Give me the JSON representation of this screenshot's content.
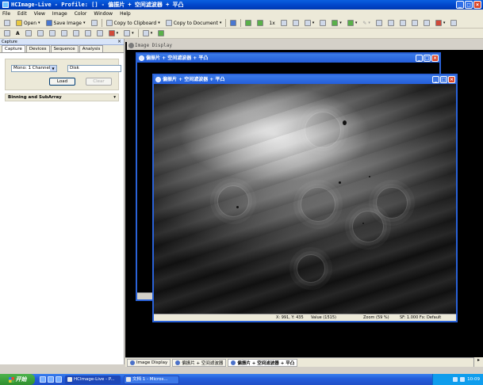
{
  "app": {
    "title": "HCImage-Live - Profile: [] - 偏振片 + 空间滤波器 + 平凸",
    "window_buttons": {
      "minimize": "_",
      "maximize": "□",
      "close": "×"
    }
  },
  "menu": [
    "File",
    "Edit",
    "View",
    "Image",
    "Color",
    "Window",
    "Help"
  ],
  "toolbar1": {
    "open": "Open",
    "save_image": "Save Image",
    "copy_clipboard": "Copy to Clipboard",
    "copy_document": "Copy to Document",
    "zoom_1x": "1x"
  },
  "capture": {
    "header": "Capture",
    "close": "×",
    "tabs": [
      "Capture",
      "Devices",
      "Sequence",
      "Analysis"
    ],
    "channel_select": "Mono: 1 Channel",
    "source_field": "Disk",
    "load_button": "Load",
    "clear_button": "Clear",
    "binning_section": "Binning and SubArray",
    "binning_chevron": "▾"
  },
  "image_display": {
    "title": "Image Display"
  },
  "windows": {
    "back_title": "偏振片 + 空间滤波器 + 平凸",
    "front_title": "偏振片 + 空间滤波器 + 平凸",
    "status": {
      "coords": "X: 991, Y: 435",
      "value": "Value (1515)",
      "zoom": "Zoom (59 %)",
      "sf": "SF: 1.000 Fx: Default"
    }
  },
  "mdi_tabs": [
    {
      "label": "Image Display",
      "active": false
    },
    {
      "label": "偏振片 + 空间滤波器",
      "active": false
    },
    {
      "label": "偏振片 + 空间滤波器 + 平凸",
      "active": true
    }
  ],
  "taskbar": {
    "start": "开始",
    "tasks": [
      {
        "label": "HCImage-Live - P...",
        "active": true
      },
      {
        "label": "文档 1 - Micros...",
        "active": false
      }
    ],
    "clock": "10:09"
  }
}
